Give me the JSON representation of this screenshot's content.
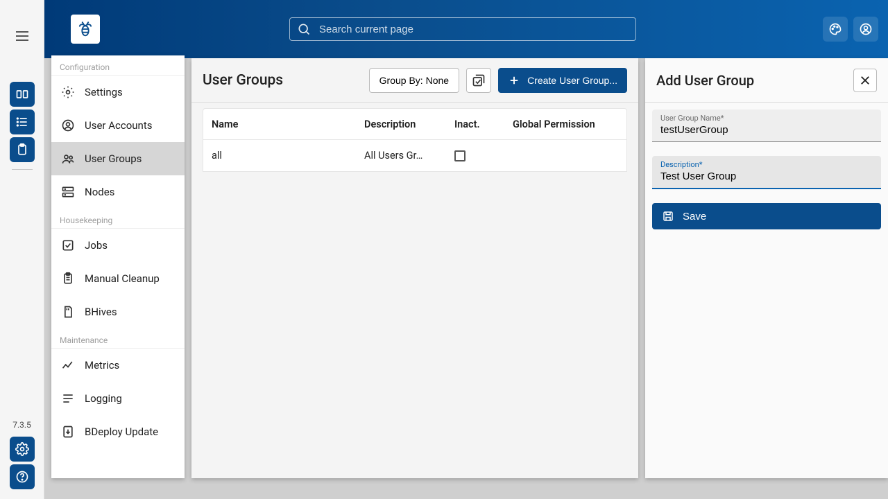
{
  "app": {
    "version": "7.3.5"
  },
  "search": {
    "placeholder": "Search current page"
  },
  "rail": {
    "items": [
      "workspace",
      "list",
      "clipboard"
    ],
    "bottom": [
      "settings",
      "help"
    ]
  },
  "sidebar": {
    "sections": [
      {
        "label": "Configuration",
        "items": [
          {
            "id": "settings",
            "label": "Settings",
            "icon": "gear"
          },
          {
            "id": "user-accounts",
            "label": "User Accounts",
            "icon": "user-circle"
          },
          {
            "id": "user-groups",
            "label": "User Groups",
            "icon": "users",
            "active": true
          },
          {
            "id": "nodes",
            "label": "Nodes",
            "icon": "server"
          }
        ]
      },
      {
        "label": "Housekeeping",
        "items": [
          {
            "id": "jobs",
            "label": "Jobs",
            "icon": "check-square"
          },
          {
            "id": "manual-cleanup",
            "label": "Manual Cleanup",
            "icon": "clipboard-list"
          },
          {
            "id": "bhives",
            "label": "BHives",
            "icon": "sd-card"
          }
        ]
      },
      {
        "label": "Maintenance",
        "items": [
          {
            "id": "metrics",
            "label": "Metrics",
            "icon": "chart-line"
          },
          {
            "id": "logging",
            "label": "Logging",
            "icon": "lines"
          },
          {
            "id": "bdeploy-update",
            "label": "BDeploy Update",
            "icon": "download-box"
          }
        ]
      }
    ]
  },
  "main": {
    "title": "User Groups",
    "group_by_label": "Group By: None",
    "create_label": "Create User Group...",
    "columns": [
      "Name",
      "Description",
      "Inact.",
      "Global Permission"
    ],
    "rows": [
      {
        "name": "all",
        "description": "All Users Gr…",
        "inactive": false,
        "global_permission": ""
      }
    ]
  },
  "drawer": {
    "title": "Add User Group",
    "fields": {
      "name": {
        "label": "User Group Name*",
        "value": "testUserGroup"
      },
      "description": {
        "label": "Description*",
        "value": "Test User Group"
      }
    },
    "save_label": "Save"
  }
}
